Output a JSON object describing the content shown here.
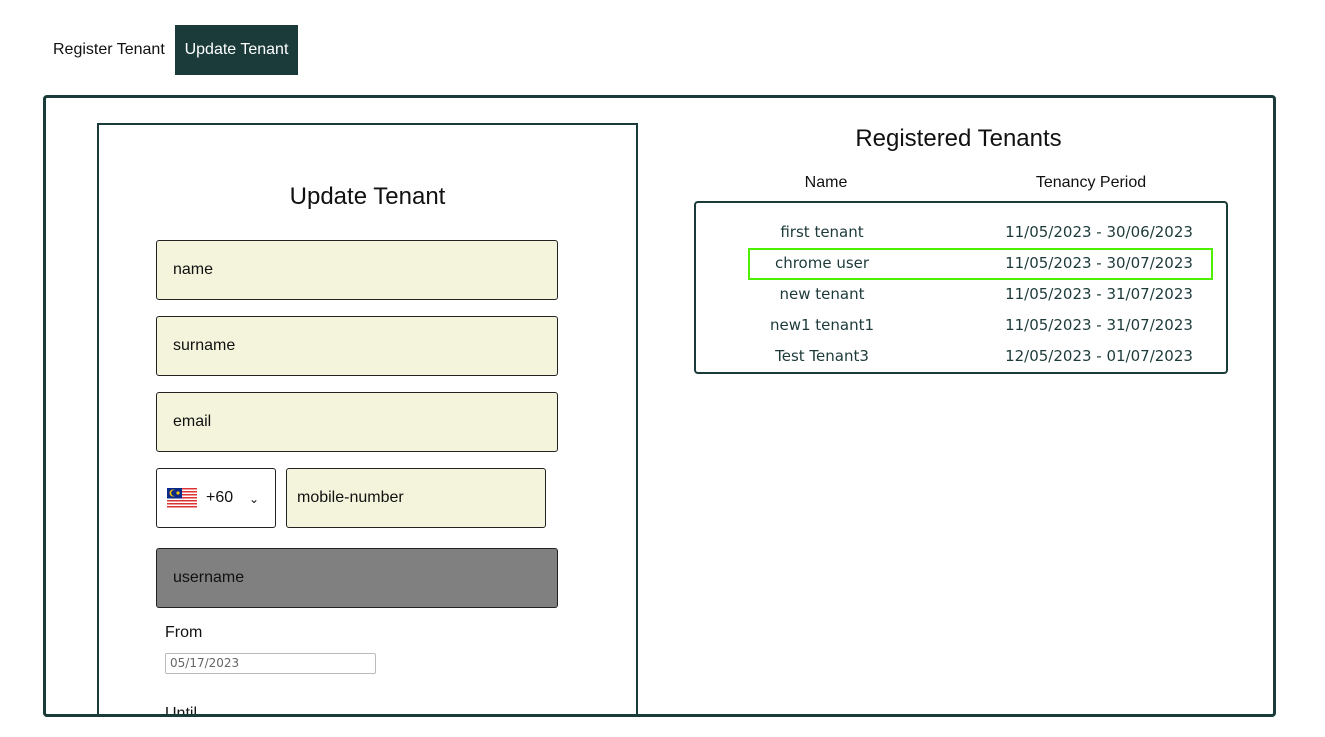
{
  "tabs": {
    "register": "Register Tenant",
    "update": "Update Tenant"
  },
  "form": {
    "title": "Update Tenant",
    "name_placeholder": "name",
    "surname_placeholder": "surname",
    "email_placeholder": "email",
    "country_code": "+60",
    "country_flag": "malaysia-flag",
    "mobile_placeholder": "mobile-number",
    "username_placeholder": "username",
    "from_label": "From",
    "from_value": "05/17/2023",
    "until_label": "Until"
  },
  "tenants": {
    "title": "Registered Tenants",
    "headers": [
      "Name",
      "Tenancy Period"
    ],
    "rows": [
      {
        "name": "first tenant",
        "period": "11/05/2023 - 30/06/2023"
      },
      {
        "name": "chrome user",
        "period": "11/05/2023 - 30/07/2023"
      },
      {
        "name": "new tenant",
        "period": "11/05/2023 - 31/07/2023"
      },
      {
        "name": "new1 tenant1",
        "period": "11/05/2023 - 31/07/2023"
      },
      {
        "name": "Test Tenant3",
        "period": "12/05/2023 - 01/07/2023"
      }
    ],
    "highlighted_row": 1,
    "highlight_color": "#4cf000"
  },
  "colors": {
    "accent": "#1b3b3b",
    "input_bg": "#f4f4dc",
    "disabled_bg": "#808080"
  }
}
